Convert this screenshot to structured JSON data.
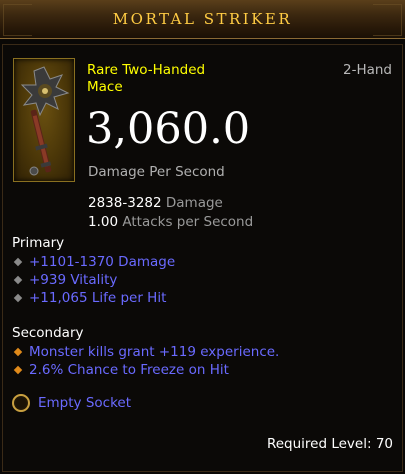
{
  "item": {
    "name": "MORTAL STRIKER",
    "type": "Rare Two-Handed Mace",
    "slot": "2-Hand",
    "icon": "mace-icon",
    "dps": "3,060.0",
    "dps_label": "Damage Per Second",
    "damage": {
      "value": "2838-3282",
      "label": "Damage"
    },
    "attacks": {
      "value": "1.00",
      "label": "Attacks per Second"
    }
  },
  "primary": {
    "heading": "Primary",
    "affixes": [
      "+1101-1370 Damage",
      "+939 Vitality",
      "+11,065 Life per Hit"
    ]
  },
  "secondary": {
    "heading": "Secondary",
    "affixes": [
      "Monster kills grant +119 experience.",
      "2.6% Chance to Freeze on Hit"
    ]
  },
  "socket": {
    "label": "Empty Socket",
    "icon": "socket-icon"
  },
  "required_level": "Required Level: 70",
  "colors": {
    "rare": "#ffff00",
    "affix": "#6a6aff",
    "title": "#ffcc44",
    "secondary_bullet": "#e08a1a"
  }
}
